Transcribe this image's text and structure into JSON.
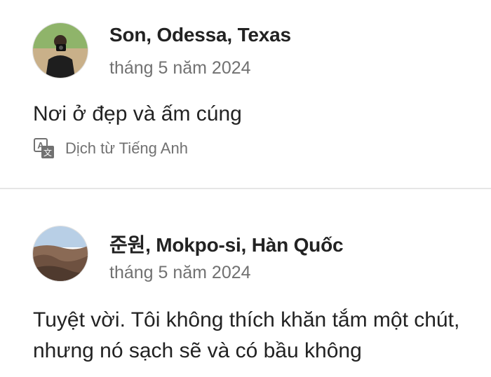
{
  "reviews": [
    {
      "name": "Son, Odessa, Texas",
      "date": "tháng 5 năm 2024",
      "text": "Nơi ở đẹp và ấm cúng",
      "translate_label": "Dịch từ Tiếng Anh",
      "translate_icon": "translate-icon",
      "avatar": "user-photo-avatar"
    },
    {
      "name": "준원, Mokpo-si, Hàn Quốc",
      "date": "tháng 5 năm 2024",
      "text": "Tuyệt vời. Tôi không thích khăn tắm một chút, nhưng nó sạch sẽ và có bầu không",
      "avatar": "landscape-photo-avatar"
    }
  ]
}
